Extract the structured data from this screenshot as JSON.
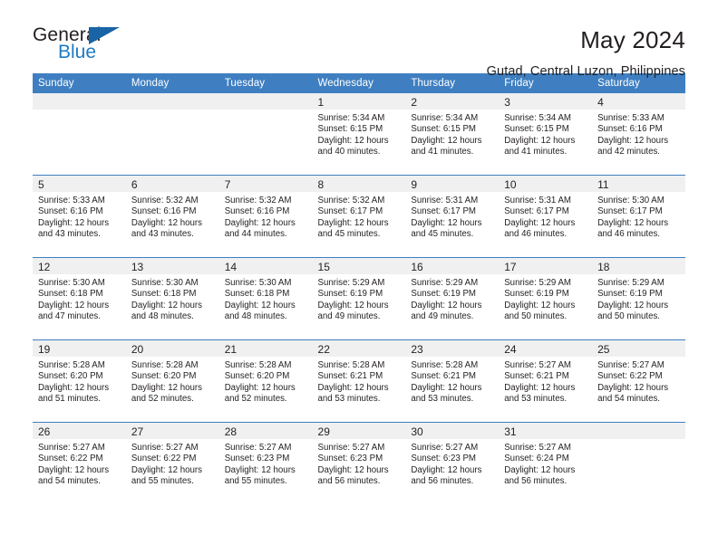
{
  "brand": {
    "name_top": "General",
    "name_bottom": "Blue",
    "triangle_icon": "triangle-icon",
    "color_dark": "#231f20",
    "color_blue": "#1f7ac4"
  },
  "header": {
    "title": "May 2024",
    "subtitle": "Gutad, Central Luzon, Philippines"
  },
  "theme": {
    "header_band": "#3f7fc1",
    "day_band": "#f0f0f0",
    "text": "#231f20"
  },
  "calendar": {
    "weekday_headers": [
      "Sunday",
      "Monday",
      "Tuesday",
      "Wednesday",
      "Thursday",
      "Friday",
      "Saturday"
    ],
    "weeks": [
      [
        {
          "day": "",
          "lines": []
        },
        {
          "day": "",
          "lines": []
        },
        {
          "day": "",
          "lines": []
        },
        {
          "day": "1",
          "lines": [
            "Sunrise: 5:34 AM",
            "Sunset: 6:15 PM",
            "Daylight: 12 hours",
            "and 40 minutes."
          ]
        },
        {
          "day": "2",
          "lines": [
            "Sunrise: 5:34 AM",
            "Sunset: 6:15 PM",
            "Daylight: 12 hours",
            "and 41 minutes."
          ]
        },
        {
          "day": "3",
          "lines": [
            "Sunrise: 5:34 AM",
            "Sunset: 6:15 PM",
            "Daylight: 12 hours",
            "and 41 minutes."
          ]
        },
        {
          "day": "4",
          "lines": [
            "Sunrise: 5:33 AM",
            "Sunset: 6:16 PM",
            "Daylight: 12 hours",
            "and 42 minutes."
          ]
        }
      ],
      [
        {
          "day": "5",
          "lines": [
            "Sunrise: 5:33 AM",
            "Sunset: 6:16 PM",
            "Daylight: 12 hours",
            "and 43 minutes."
          ]
        },
        {
          "day": "6",
          "lines": [
            "Sunrise: 5:32 AM",
            "Sunset: 6:16 PM",
            "Daylight: 12 hours",
            "and 43 minutes."
          ]
        },
        {
          "day": "7",
          "lines": [
            "Sunrise: 5:32 AM",
            "Sunset: 6:16 PM",
            "Daylight: 12 hours",
            "and 44 minutes."
          ]
        },
        {
          "day": "8",
          "lines": [
            "Sunrise: 5:32 AM",
            "Sunset: 6:17 PM",
            "Daylight: 12 hours",
            "and 45 minutes."
          ]
        },
        {
          "day": "9",
          "lines": [
            "Sunrise: 5:31 AM",
            "Sunset: 6:17 PM",
            "Daylight: 12 hours",
            "and 45 minutes."
          ]
        },
        {
          "day": "10",
          "lines": [
            "Sunrise: 5:31 AM",
            "Sunset: 6:17 PM",
            "Daylight: 12 hours",
            "and 46 minutes."
          ]
        },
        {
          "day": "11",
          "lines": [
            "Sunrise: 5:30 AM",
            "Sunset: 6:17 PM",
            "Daylight: 12 hours",
            "and 46 minutes."
          ]
        }
      ],
      [
        {
          "day": "12",
          "lines": [
            "Sunrise: 5:30 AM",
            "Sunset: 6:18 PM",
            "Daylight: 12 hours",
            "and 47 minutes."
          ]
        },
        {
          "day": "13",
          "lines": [
            "Sunrise: 5:30 AM",
            "Sunset: 6:18 PM",
            "Daylight: 12 hours",
            "and 48 minutes."
          ]
        },
        {
          "day": "14",
          "lines": [
            "Sunrise: 5:30 AM",
            "Sunset: 6:18 PM",
            "Daylight: 12 hours",
            "and 48 minutes."
          ]
        },
        {
          "day": "15",
          "lines": [
            "Sunrise: 5:29 AM",
            "Sunset: 6:19 PM",
            "Daylight: 12 hours",
            "and 49 minutes."
          ]
        },
        {
          "day": "16",
          "lines": [
            "Sunrise: 5:29 AM",
            "Sunset: 6:19 PM",
            "Daylight: 12 hours",
            "and 49 minutes."
          ]
        },
        {
          "day": "17",
          "lines": [
            "Sunrise: 5:29 AM",
            "Sunset: 6:19 PM",
            "Daylight: 12 hours",
            "and 50 minutes."
          ]
        },
        {
          "day": "18",
          "lines": [
            "Sunrise: 5:29 AM",
            "Sunset: 6:19 PM",
            "Daylight: 12 hours",
            "and 50 minutes."
          ]
        }
      ],
      [
        {
          "day": "19",
          "lines": [
            "Sunrise: 5:28 AM",
            "Sunset: 6:20 PM",
            "Daylight: 12 hours",
            "and 51 minutes."
          ]
        },
        {
          "day": "20",
          "lines": [
            "Sunrise: 5:28 AM",
            "Sunset: 6:20 PM",
            "Daylight: 12 hours",
            "and 52 minutes."
          ]
        },
        {
          "day": "21",
          "lines": [
            "Sunrise: 5:28 AM",
            "Sunset: 6:20 PM",
            "Daylight: 12 hours",
            "and 52 minutes."
          ]
        },
        {
          "day": "22",
          "lines": [
            "Sunrise: 5:28 AM",
            "Sunset: 6:21 PM",
            "Daylight: 12 hours",
            "and 53 minutes."
          ]
        },
        {
          "day": "23",
          "lines": [
            "Sunrise: 5:28 AM",
            "Sunset: 6:21 PM",
            "Daylight: 12 hours",
            "and 53 minutes."
          ]
        },
        {
          "day": "24",
          "lines": [
            "Sunrise: 5:27 AM",
            "Sunset: 6:21 PM",
            "Daylight: 12 hours",
            "and 53 minutes."
          ]
        },
        {
          "day": "25",
          "lines": [
            "Sunrise: 5:27 AM",
            "Sunset: 6:22 PM",
            "Daylight: 12 hours",
            "and 54 minutes."
          ]
        }
      ],
      [
        {
          "day": "26",
          "lines": [
            "Sunrise: 5:27 AM",
            "Sunset: 6:22 PM",
            "Daylight: 12 hours",
            "and 54 minutes."
          ]
        },
        {
          "day": "27",
          "lines": [
            "Sunrise: 5:27 AM",
            "Sunset: 6:22 PM",
            "Daylight: 12 hours",
            "and 55 minutes."
          ]
        },
        {
          "day": "28",
          "lines": [
            "Sunrise: 5:27 AM",
            "Sunset: 6:23 PM",
            "Daylight: 12 hours",
            "and 55 minutes."
          ]
        },
        {
          "day": "29",
          "lines": [
            "Sunrise: 5:27 AM",
            "Sunset: 6:23 PM",
            "Daylight: 12 hours",
            "and 56 minutes."
          ]
        },
        {
          "day": "30",
          "lines": [
            "Sunrise: 5:27 AM",
            "Sunset: 6:23 PM",
            "Daylight: 12 hours",
            "and 56 minutes."
          ]
        },
        {
          "day": "31",
          "lines": [
            "Sunrise: 5:27 AM",
            "Sunset: 6:24 PM",
            "Daylight: 12 hours",
            "and 56 minutes."
          ]
        },
        {
          "day": "",
          "lines": []
        }
      ]
    ]
  }
}
